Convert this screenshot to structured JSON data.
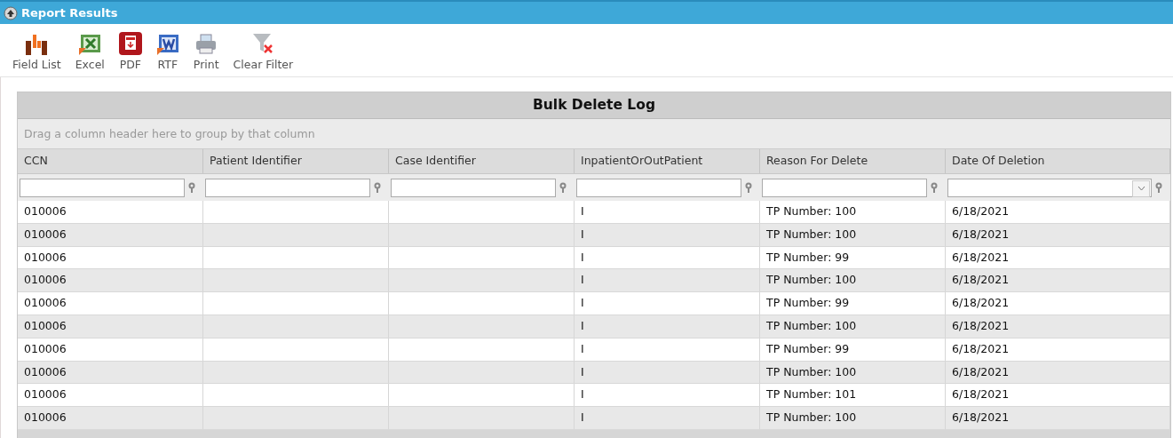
{
  "panel": {
    "title": "Report Results",
    "expanded": true
  },
  "toolbar": [
    {
      "label": "Field List",
      "kind": "field-list"
    },
    {
      "label": "Excel",
      "kind": "excel"
    },
    {
      "label": "PDF",
      "kind": "pdf"
    },
    {
      "label": "RTF",
      "kind": "rtf"
    },
    {
      "label": "Print",
      "kind": "print"
    },
    {
      "label": "Clear Filter",
      "kind": "clear-filter"
    }
  ],
  "grid": {
    "title": "Bulk Delete Log",
    "group_hint": "Drag a column header here to group by that column",
    "columns": [
      {
        "label": "CCN",
        "kind": "text"
      },
      {
        "label": "Patient Identifier",
        "kind": "text"
      },
      {
        "label": "Case Identifier",
        "kind": "text"
      },
      {
        "label": "InpatientOrOutPatient",
        "kind": "text"
      },
      {
        "label": "Reason For Delete",
        "kind": "text"
      },
      {
        "label": "Date Of Deletion",
        "kind": "dropdown"
      }
    ],
    "rows": [
      {
        "ccn": "010006",
        "inpatient_or_outpatient": "I",
        "reason_for_delete": "TP Number: 100",
        "date_of_deletion": "6/18/2021"
      },
      {
        "ccn": "010006",
        "inpatient_or_outpatient": "I",
        "reason_for_delete": "TP Number: 100",
        "date_of_deletion": "6/18/2021"
      },
      {
        "ccn": "010006",
        "inpatient_or_outpatient": "I",
        "reason_for_delete": "TP Number: 99",
        "date_of_deletion": "6/18/2021"
      },
      {
        "ccn": "010006",
        "inpatient_or_outpatient": "I",
        "reason_for_delete": "TP Number: 100",
        "date_of_deletion": "6/18/2021"
      },
      {
        "ccn": "010006",
        "inpatient_or_outpatient": "I",
        "reason_for_delete": "TP Number: 99",
        "date_of_deletion": "6/18/2021"
      },
      {
        "ccn": "010006",
        "inpatient_or_outpatient": "I",
        "reason_for_delete": "TP Number: 100",
        "date_of_deletion": "6/18/2021"
      },
      {
        "ccn": "010006",
        "inpatient_or_outpatient": "I",
        "reason_for_delete": "TP Number: 99",
        "date_of_deletion": "6/18/2021"
      },
      {
        "ccn": "010006",
        "inpatient_or_outpatient": "I",
        "reason_for_delete": "TP Number: 100",
        "date_of_deletion": "6/18/2021"
      },
      {
        "ccn": "010006",
        "inpatient_or_outpatient": "I",
        "reason_for_delete": "TP Number: 101",
        "date_of_deletion": "6/18/2021"
      },
      {
        "ccn": "010006",
        "inpatient_or_outpatient": "I",
        "reason_for_delete": "TP Number: 100",
        "date_of_deletion": "6/18/2021"
      }
    ]
  }
}
